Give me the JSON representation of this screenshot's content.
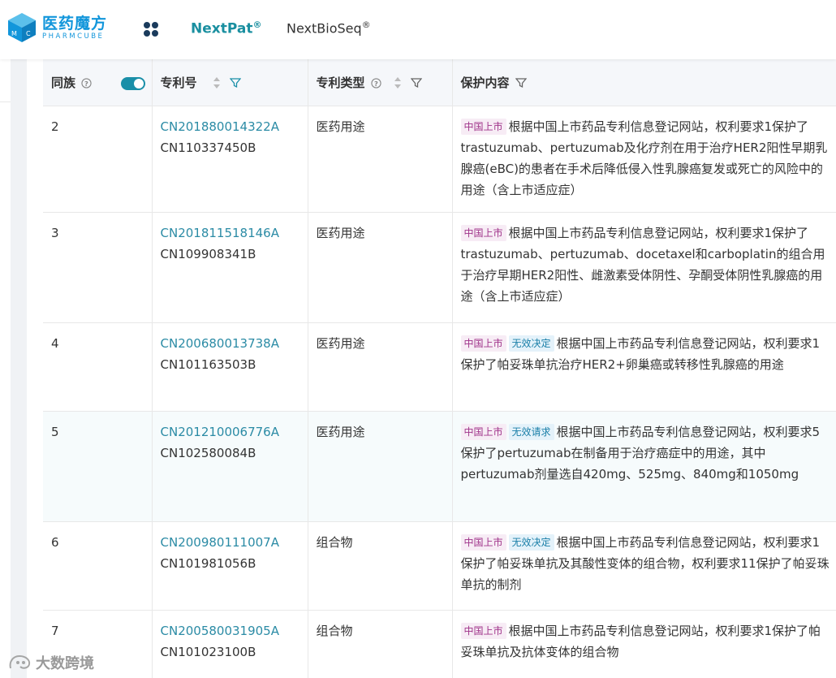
{
  "brand": {
    "cn": "医药魔方",
    "en": "PHARMCUBE"
  },
  "nav": {
    "nextpat": "NextPat",
    "nextbioseq": "NextBioSeq",
    "reg": "®"
  },
  "table": {
    "headers": {
      "family": "同族",
      "patent_no": "专利号",
      "patent_type": "专利类型",
      "protection": "保护内容"
    },
    "rows": [
      {
        "family": "2",
        "patent_link": "CN201880014322A",
        "patent_sub": "CN110337450B",
        "type": "医药用途",
        "tags": [
          "中国上市"
        ],
        "content": "根据中国上市药品专利信息登记网站，权利要求1保护了trastuzumab、pertuzumab及化疗剂在用于治疗HER2阳性早期乳腺癌(eBC)的患者在手术后降低侵入性乳腺癌复发或死亡的风险中的用途（含上市适应症）"
      },
      {
        "family": "3",
        "patent_link": "CN201811518146A",
        "patent_sub": "CN109908341B",
        "type": "医药用途",
        "tags": [
          "中国上市"
        ],
        "content": "根据中国上市药品专利信息登记网站，权利要求1保护了trastuzumab、pertuzumab、docetaxel和carboplatin的组合用于治疗早期HER2阳性、雌激素受体阴性、孕酮受体阴性乳腺癌的用途（含上市适应症）"
      },
      {
        "family": "4",
        "patent_link": "CN200680013738A",
        "patent_sub": "CN101163503B",
        "type": "医药用途",
        "tags": [
          "中国上市",
          "无效决定"
        ],
        "content": "根据中国上市药品专利信息登记网站，权利要求1保护了帕妥珠单抗治疗HER2+卵巢癌或转移性乳腺癌的用途"
      },
      {
        "family": "5",
        "patent_link": "CN201210006776A",
        "patent_sub": "CN102580084B",
        "type": "医药用途",
        "tags": [
          "中国上市",
          "无效请求"
        ],
        "content": "根据中国上市药品专利信息登记网站，权利要求5保护了pertuzumab在制备用于治疗癌症中的用途，其中pertuzumab剂量选自420mg、525mg、840mg和1050mg"
      },
      {
        "family": "6",
        "patent_link": "CN200980111007A",
        "patent_sub": "CN101981056B",
        "type": "组合物",
        "tags": [
          "中国上市",
          "无效决定"
        ],
        "content": "根据中国上市药品专利信息登记网站，权利要求1保护了帕妥珠单抗及其酸性变体的组合物，权利要求11保护了帕妥珠单抗的制剂"
      },
      {
        "family": "7",
        "patent_link": "CN200580031905A",
        "patent_sub": "CN101023100B",
        "type": "组合物",
        "tags": [
          "中国上市"
        ],
        "content": "根据中国上市药品专利信息登记网站，权利要求1保护了帕妥珠单抗及抗体变体的组合物"
      }
    ]
  },
  "watermark": "大数跨境",
  "colors": {
    "accent": "#1a8fa0",
    "link": "#2b8ba5",
    "tag_cn_bg": "#f7ecf5",
    "tag_inv_bg": "#e4f2fa"
  }
}
